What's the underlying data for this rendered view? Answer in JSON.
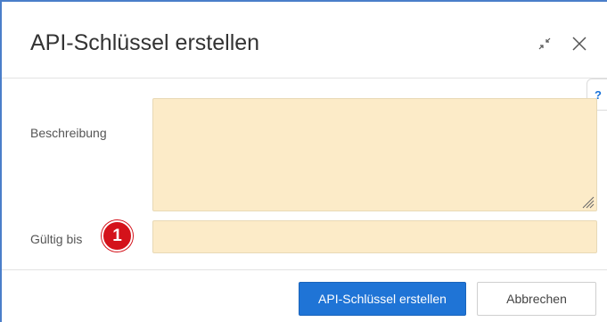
{
  "dialog": {
    "title": "API-Schlüssel erstellen",
    "minimize_icon": "minimize-arrows-icon",
    "close_icon": "close-icon",
    "help_label": "?"
  },
  "form": {
    "description_label": "Beschreibung",
    "description_value": "",
    "valid_until_label": "Gültig bis",
    "valid_until_value": "",
    "step_badge": "1"
  },
  "footer": {
    "create_label": "API-Schlüssel erstellen",
    "cancel_label": "Abbrechen"
  },
  "colors": {
    "accent": "#1f74d6",
    "field_background": "#fcebc8",
    "badge": "#d4121a"
  }
}
